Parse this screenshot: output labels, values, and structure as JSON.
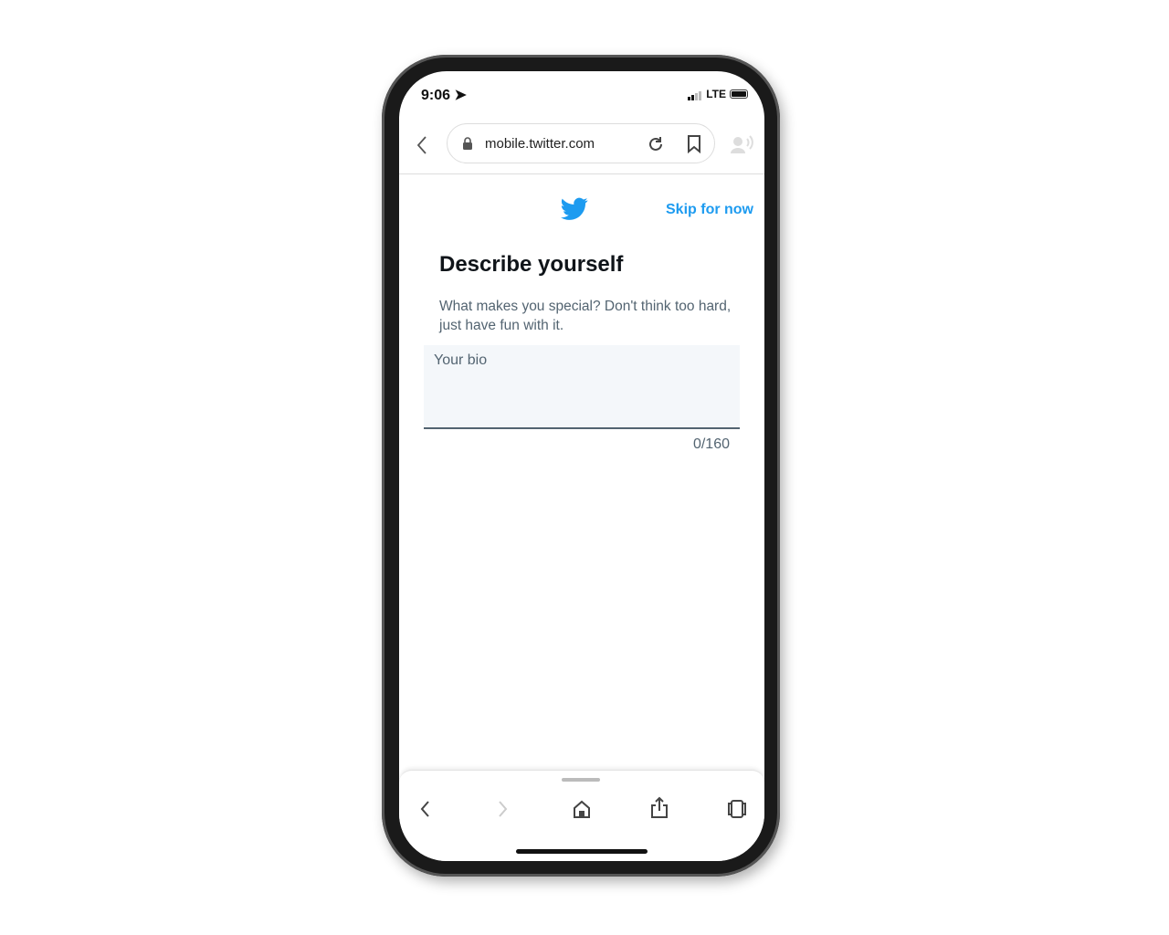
{
  "status": {
    "time": "9:06",
    "network": "LTE"
  },
  "browser": {
    "url": "mobile.twitter.com"
  },
  "page": {
    "skip_label": "Skip for now",
    "title": "Describe yourself",
    "subtitle": "What makes you special? Don't think too hard, just have fun with it.",
    "bio_placeholder": "Your bio",
    "counter": "0/160"
  },
  "colors": {
    "accent": "#1d9bf0"
  }
}
